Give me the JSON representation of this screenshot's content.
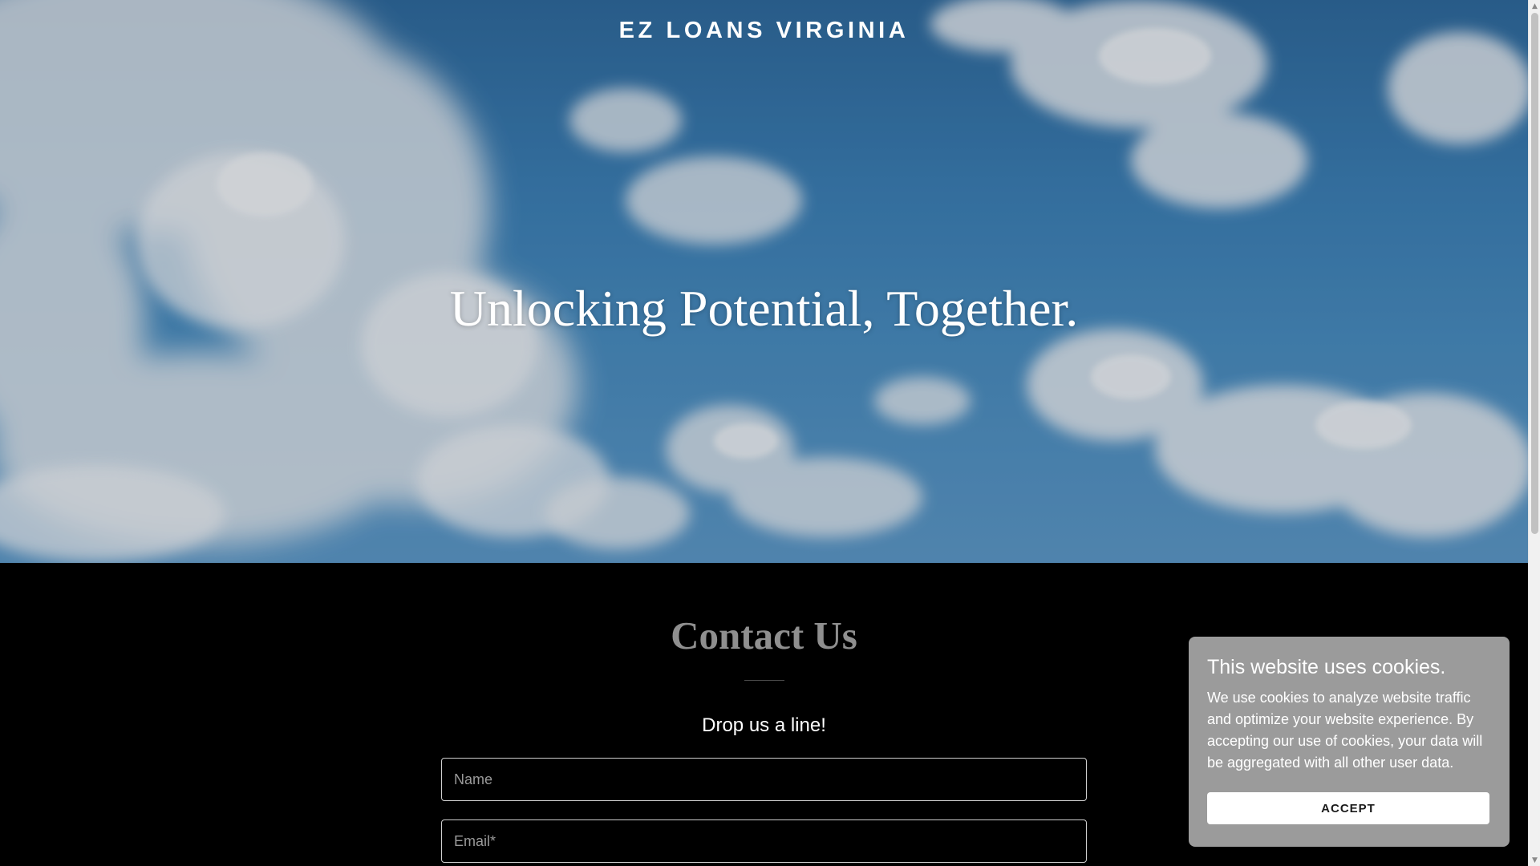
{
  "header": {
    "brand": "EZ LOANS VIRGINIA"
  },
  "hero": {
    "title": "Unlocking Potential, Together."
  },
  "contact": {
    "title": "Contact Us",
    "subtitle": "Drop us a line!",
    "name_placeholder": "Name",
    "email_placeholder": "Email*"
  },
  "cookie_banner": {
    "title": "This website uses cookies.",
    "body": "We use cookies to analyze website traffic and optimize your website experience. By accepting our use of cookies, your data will be aggregated with all other user data.",
    "accept_label": "ACCEPT"
  },
  "colors": {
    "sky": "#3d82b8",
    "page_background": "#000000",
    "contact_title": "#8f8f8f",
    "cookie_background": "#9b9b9b"
  }
}
